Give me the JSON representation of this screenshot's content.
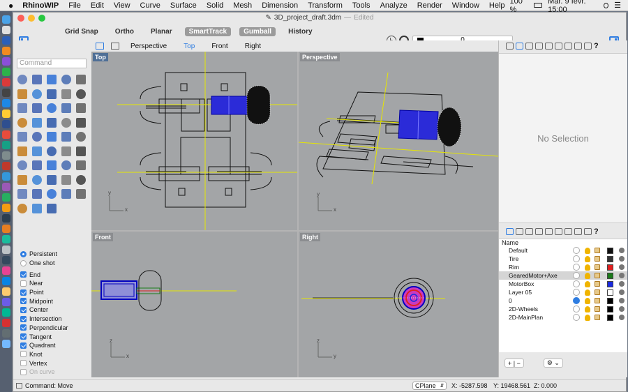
{
  "menubar": {
    "apple": "",
    "app": "RhinoWIP",
    "items": [
      "File",
      "Edit",
      "View",
      "Curve",
      "Surface",
      "Solid",
      "Mesh",
      "Dimension",
      "Transform",
      "Tools",
      "Analyze",
      "Render",
      "Window",
      "Help"
    ],
    "battery": "100 %",
    "datetime": "Mar. 9 févr. 15:00"
  },
  "window": {
    "title": "3D_project_draft.3dm",
    "edited": "Edited"
  },
  "toolbar": {
    "buttons": [
      "Grid Snap",
      "Ortho",
      "Planar",
      "SmartTrack",
      "Gumball",
      "History"
    ],
    "active": [
      false,
      false,
      false,
      true,
      true,
      false
    ],
    "layer_value": "0"
  },
  "command": {
    "placeholder": "Command"
  },
  "viewtabs": [
    "Perspective",
    "Top",
    "Front",
    "Right"
  ],
  "viewports": {
    "top": "Top",
    "perspective": "Perspective",
    "front": "Front",
    "right": "Right"
  },
  "osnaps": {
    "persistent": "Persistent",
    "oneshot": "One shot",
    "items": [
      {
        "label": "End",
        "on": true
      },
      {
        "label": "Near",
        "on": false
      },
      {
        "label": "Point",
        "on": true
      },
      {
        "label": "Midpoint",
        "on": true
      },
      {
        "label": "Center",
        "on": true
      },
      {
        "label": "Intersection",
        "on": true
      },
      {
        "label": "Perpendicular",
        "on": true
      },
      {
        "label": "Tangent",
        "on": true
      },
      {
        "label": "Quadrant",
        "on": true
      },
      {
        "label": "Knot",
        "on": false
      },
      {
        "label": "Vertex",
        "on": false
      },
      {
        "label": "On curve",
        "on": false
      }
    ]
  },
  "properties": {
    "empty": "No Selection"
  },
  "layers": {
    "header": "Name",
    "rows": [
      {
        "name": "Default",
        "color": "#111111",
        "current": false,
        "sel": false
      },
      {
        "name": "Tire",
        "color": "#333333",
        "current": false,
        "sel": false
      },
      {
        "name": "Rim",
        "color": "#e02020",
        "current": false,
        "sel": false
      },
      {
        "name": "GearedMotor+Axe",
        "color": "#1a7a1a",
        "current": false,
        "sel": true
      },
      {
        "name": "MotorBox",
        "color": "#1a2ae0",
        "current": false,
        "sel": false
      },
      {
        "name": "Layer 05",
        "color": "#ffffff",
        "current": false,
        "sel": false
      },
      {
        "name": "0",
        "color": "#000000",
        "current": true,
        "sel": false
      },
      {
        "name": "2D-Wheels",
        "color": "#000000",
        "current": false,
        "sel": false
      },
      {
        "name": "2D-MainPlan",
        "color": "#000000",
        "current": false,
        "sel": false
      }
    ]
  },
  "status": {
    "command": "Command: Move",
    "cplane": "CPlane",
    "x": "X: -5287.598",
    "y": "Y: 19468.561",
    "z": "Z: 0.000"
  },
  "axes": {
    "x": "x",
    "y": "y",
    "z": "z"
  }
}
